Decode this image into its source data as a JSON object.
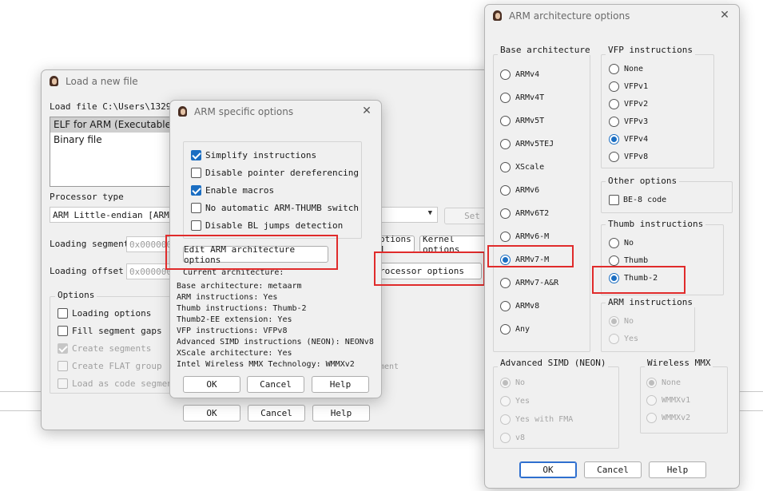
{
  "load_dialog": {
    "title": "Load a new file",
    "load_file_label": "Load file C:\\Users\\13294\\",
    "file_types": [
      "ELF for ARM (Executable)",
      "Binary file"
    ],
    "processor_type_label": "Processor type",
    "processor_value": "ARM Little-endian [ARM]",
    "set_button": "Set",
    "loading_segment_label": "Loading segment",
    "loading_segment_value": "0x000000",
    "loading_offset_label": "Loading offset",
    "loading_offset_value": "0x000000",
    "analysis_options_button": "ptions 1",
    "kernel_options_button": "Kernel options",
    "processor_options_button": "rocessor options",
    "options_group_title": "Options",
    "options": [
      {
        "label": "Loading options",
        "checked": false,
        "disabled": false
      },
      {
        "label": "Fill segment gaps",
        "checked": false,
        "disabled": false
      },
      {
        "label": "Create segments",
        "checked": true,
        "disabled": true
      },
      {
        "label": "Create FLAT group",
        "checked": false,
        "disabled": true
      },
      {
        "label": "Load as code segment",
        "checked": false,
        "disabled": true
      }
    ],
    "partial_right_option": "ment",
    "ok_button": "OK",
    "cancel_button": "Cancel",
    "help_button": "Help"
  },
  "arm_specific": {
    "title": "ARM specific options",
    "options": [
      {
        "label": "Simplify instructions",
        "checked": true
      },
      {
        "label": "Disable pointer dereferencing",
        "checked": false
      },
      {
        "label": "Enable macros",
        "checked": true
      },
      {
        "label": "No automatic ARM-THUMB switch",
        "checked": false
      },
      {
        "label": "Disable BL jumps detection",
        "checked": false
      }
    ],
    "edit_arch_button": "Edit ARM architecture options",
    "current_arch_label": "Current architecture:",
    "info_lines": [
      "Base architecture: metaarm",
      "ARM instructions: Yes",
      "Thumb instructions: Thumb-2",
      "Thumb2-EE extension: Yes",
      "VFP instructions: VFPv8",
      "Advanced SIMD instructions (NEON): NEONv8",
      "XScale architecture: Yes",
      "Intel Wireless MMX Technology: WMMXv2"
    ],
    "ok_button": "OK",
    "cancel_button": "Cancel",
    "help_button": "Help"
  },
  "arch_options": {
    "title": "ARM architecture options",
    "base_arch": {
      "title": "Base architecture",
      "items": [
        {
          "label": "ARMv4",
          "selected": false
        },
        {
          "label": "ARMv4T",
          "selected": false
        },
        {
          "label": "ARMv5T",
          "selected": false
        },
        {
          "label": "ARMv5TEJ",
          "selected": false
        },
        {
          "label": "XScale",
          "selected": false
        },
        {
          "label": "ARMv6",
          "selected": false
        },
        {
          "label": "ARMv6T2",
          "selected": false
        },
        {
          "label": "ARMv6-M",
          "selected": false
        },
        {
          "label": "ARMv7-M",
          "selected": true
        },
        {
          "label": "ARMv7-A&R",
          "selected": false
        },
        {
          "label": "ARMv8",
          "selected": false
        },
        {
          "label": "Any",
          "selected": false
        }
      ]
    },
    "vfp": {
      "title": "VFP instructions",
      "items": [
        {
          "label": "None",
          "selected": false
        },
        {
          "label": "VFPv1",
          "selected": false
        },
        {
          "label": "VFPv2",
          "selected": false
        },
        {
          "label": "VFPv3",
          "selected": false
        },
        {
          "label": "VFPv4",
          "selected": true
        },
        {
          "label": "VFPv8",
          "selected": false
        }
      ]
    },
    "other": {
      "title": "Other options",
      "be8_label": "BE-8 code",
      "be8_checked": false
    },
    "thumb": {
      "title": "Thumb instructions",
      "items": [
        {
          "label": "No",
          "selected": false
        },
        {
          "label": "Thumb",
          "selected": false
        },
        {
          "label": "Thumb-2",
          "selected": true
        }
      ]
    },
    "arm_instr": {
      "title": "ARM instructions",
      "items": [
        {
          "label": "No",
          "selected": true
        },
        {
          "label": "Yes",
          "selected": false
        }
      ]
    },
    "simd": {
      "title": "Advanced SIMD (NEON)",
      "items": [
        {
          "label": "No",
          "selected": true
        },
        {
          "label": "Yes",
          "selected": false
        },
        {
          "label": "Yes with FMA",
          "selected": false
        },
        {
          "label": "v8",
          "selected": false
        }
      ]
    },
    "wmmx": {
      "title": "Wireless MMX",
      "items": [
        {
          "label": "None",
          "selected": true
        },
        {
          "label": "WMMXv1",
          "selected": false
        },
        {
          "label": "WMMXv2",
          "selected": false
        }
      ]
    },
    "ok_button": "OK",
    "cancel_button": "Cancel",
    "help_button": "Help"
  },
  "colors": {
    "accent": "#1b6ec2",
    "highlight_box": "#e02b2b",
    "dialog_bg": "#f0f0f0"
  }
}
